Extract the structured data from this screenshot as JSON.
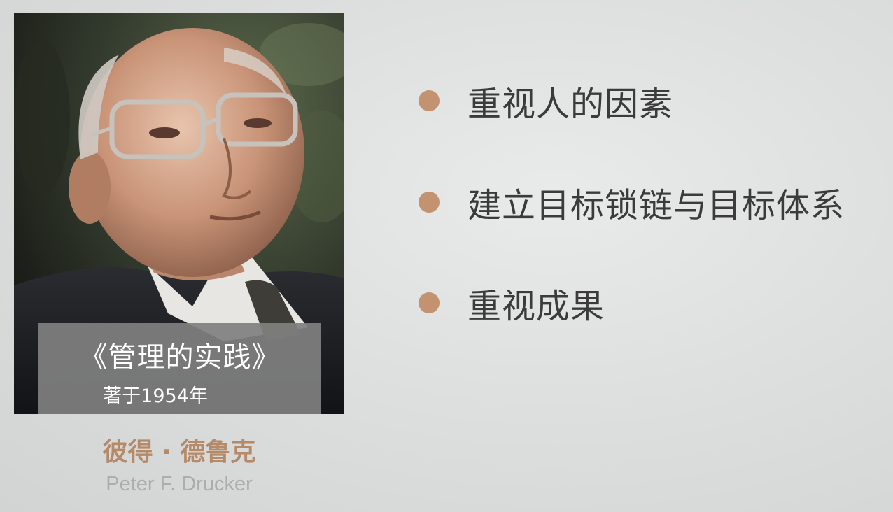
{
  "profile": {
    "book_title": "《管理的实践》",
    "book_year": "著于1954年",
    "name_cn": "彼得 · 德鲁克",
    "name_en": "Peter F. Drucker"
  },
  "points": [
    {
      "label": "重视人的因素",
      "icon": "bullet-dot"
    },
    {
      "label": "建立目标锁链与目标体系",
      "icon": "bullet-dot"
    },
    {
      "label": "重视成果",
      "icon": "bullet-dot"
    }
  ],
  "colors": {
    "accent": "#c39270",
    "name_cn": "#b58a68",
    "name_en": "#adadad",
    "text": "#3b3b3b",
    "caption_bg": "#808080"
  }
}
